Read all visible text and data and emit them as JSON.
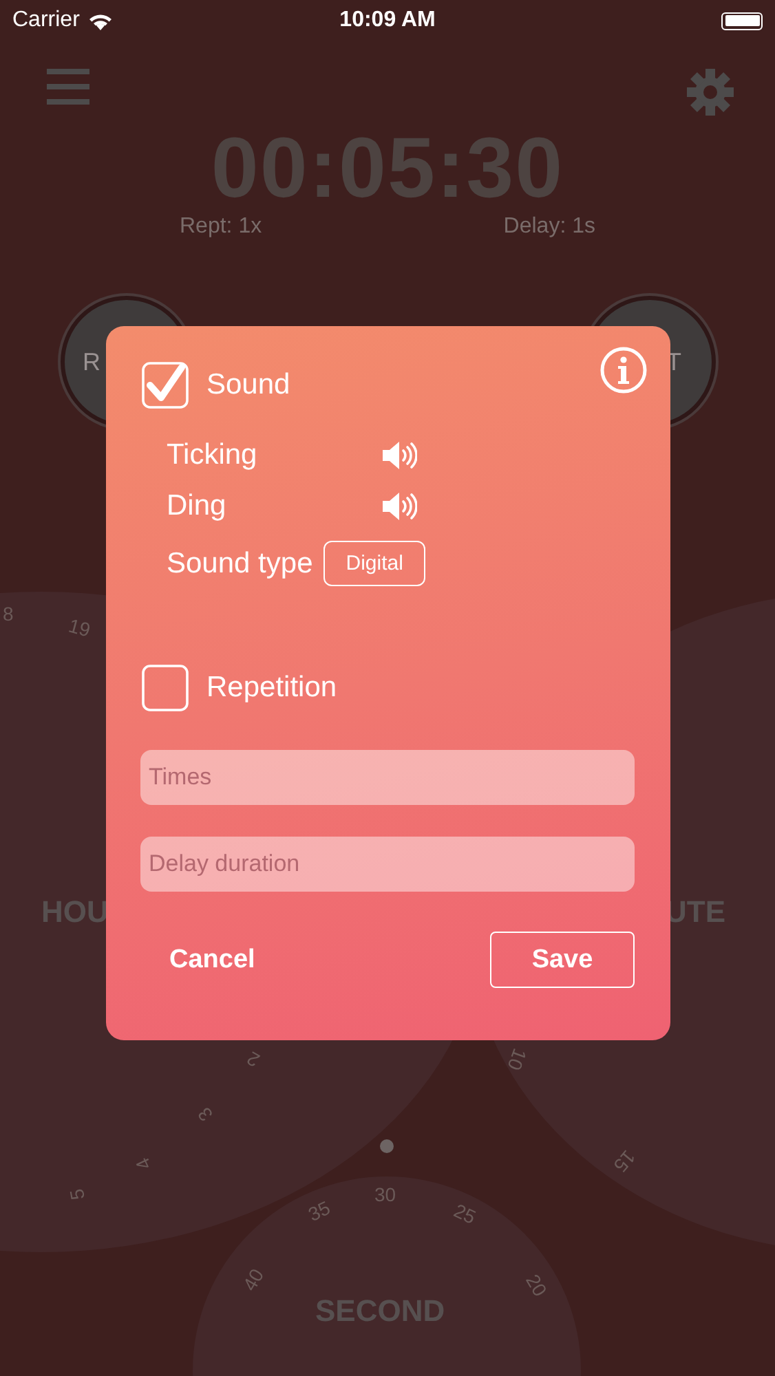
{
  "status_bar": {
    "carrier": "Carrier",
    "time": "10:09 AM"
  },
  "timer": {
    "display": "00:05:30",
    "repeat": "Rept: 1x",
    "delay": "Delay: 1s"
  },
  "round_buttons": [
    {
      "label": "R"
    },
    {
      "label": "T"
    }
  ],
  "dials": [
    {
      "label": "HOU",
      "numbers": [
        "8",
        "19",
        "2",
        "3",
        "4",
        "5"
      ]
    },
    {
      "label": "UTE",
      "numbers": [
        "10",
        "15"
      ]
    },
    {
      "label": "SECOND",
      "numbers": [
        "30",
        "35",
        "25",
        "40",
        "20"
      ]
    }
  ],
  "dialog": {
    "sound": {
      "label": "Sound",
      "checked": true
    },
    "options": [
      {
        "kind": "toggle",
        "label": "Ticking",
        "on": true
      },
      {
        "kind": "toggle",
        "label": "Ding",
        "on": true
      },
      {
        "kind": "choice",
        "label": "Sound type",
        "value": "Digital"
      }
    ],
    "repetition": {
      "label": "Repetition",
      "checked": false
    },
    "fields": [
      {
        "placeholder": "Times"
      },
      {
        "placeholder": "Delay duration"
      }
    ],
    "buttons": [
      {
        "kind": "plain",
        "label": "Cancel"
      },
      {
        "kind": "outlined",
        "label": "Save"
      }
    ]
  }
}
